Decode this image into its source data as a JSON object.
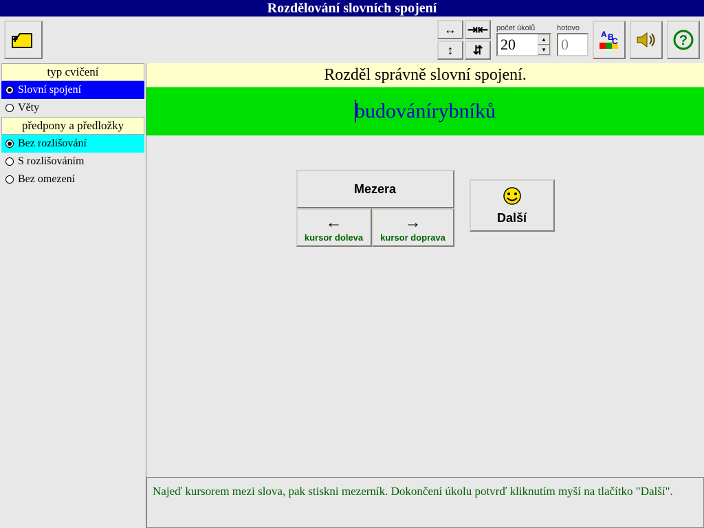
{
  "title": "Rozdělování slovních spojení",
  "toolbar": {
    "tasks_label": "počet úkolů",
    "tasks_value": "20",
    "done_label": "hotovo",
    "done_value": "0"
  },
  "sidebar": {
    "group1_header": "typ cvičení",
    "group1": [
      {
        "label": "Slovní spojení",
        "selected": true
      },
      {
        "label": "Věty",
        "selected": false
      }
    ],
    "group2_header": "předpony a předložky",
    "group2": [
      {
        "label": "Bez rozlišování",
        "selected": true
      },
      {
        "label": "S rozlišováním",
        "selected": false
      },
      {
        "label": "Bez omezení",
        "selected": false
      }
    ]
  },
  "content": {
    "instruction": "Rozděl správně slovní spojení.",
    "puzzle_word": "budovánírybníků",
    "buttons": {
      "space": "Mezera",
      "left": "kursor doleva",
      "right": "kursor doprava",
      "next": "Další"
    },
    "hint": "Najeď kursorem mezi slova, pak stiskni mezerník. Dokončení úkolu potvrď kliknutím myší na tlačítko \"Další\"."
  }
}
